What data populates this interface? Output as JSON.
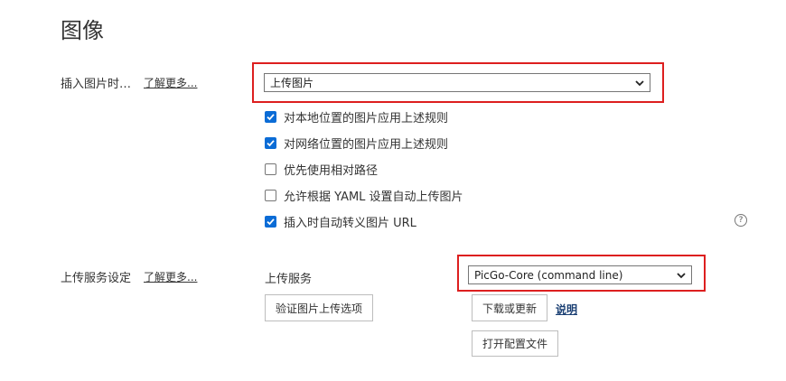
{
  "page": {
    "title": "图像"
  },
  "insert_section": {
    "label": "插入图片时…",
    "learn_more": "了解更多...",
    "select_value": "上传图片",
    "options": [
      {
        "label": "对本地位置的图片应用上述规则",
        "checked": true
      },
      {
        "label": "对网络位置的图片应用上述规则",
        "checked": true
      },
      {
        "label": "优先使用相对路径",
        "checked": false
      },
      {
        "label": "允许根据 YAML 设置自动上传图片",
        "checked": false
      },
      {
        "label": "插入时自动转义图片 URL",
        "checked": true
      }
    ],
    "help_icon": "question-circle-icon",
    "help_glyph": "?"
  },
  "upload_section": {
    "label": "上传服务设定",
    "learn_more": "了解更多...",
    "service_label": "上传服务",
    "service_value": "PicGo-Core (command line)",
    "verify_button": "验证图片上传选项",
    "download_button": "下载或更新",
    "explain_link": "说明",
    "open_config_button": "打开配置文件"
  },
  "colors": {
    "highlight_border": "#dd1f1f",
    "checkbox_accent": "#0b6cd6"
  }
}
